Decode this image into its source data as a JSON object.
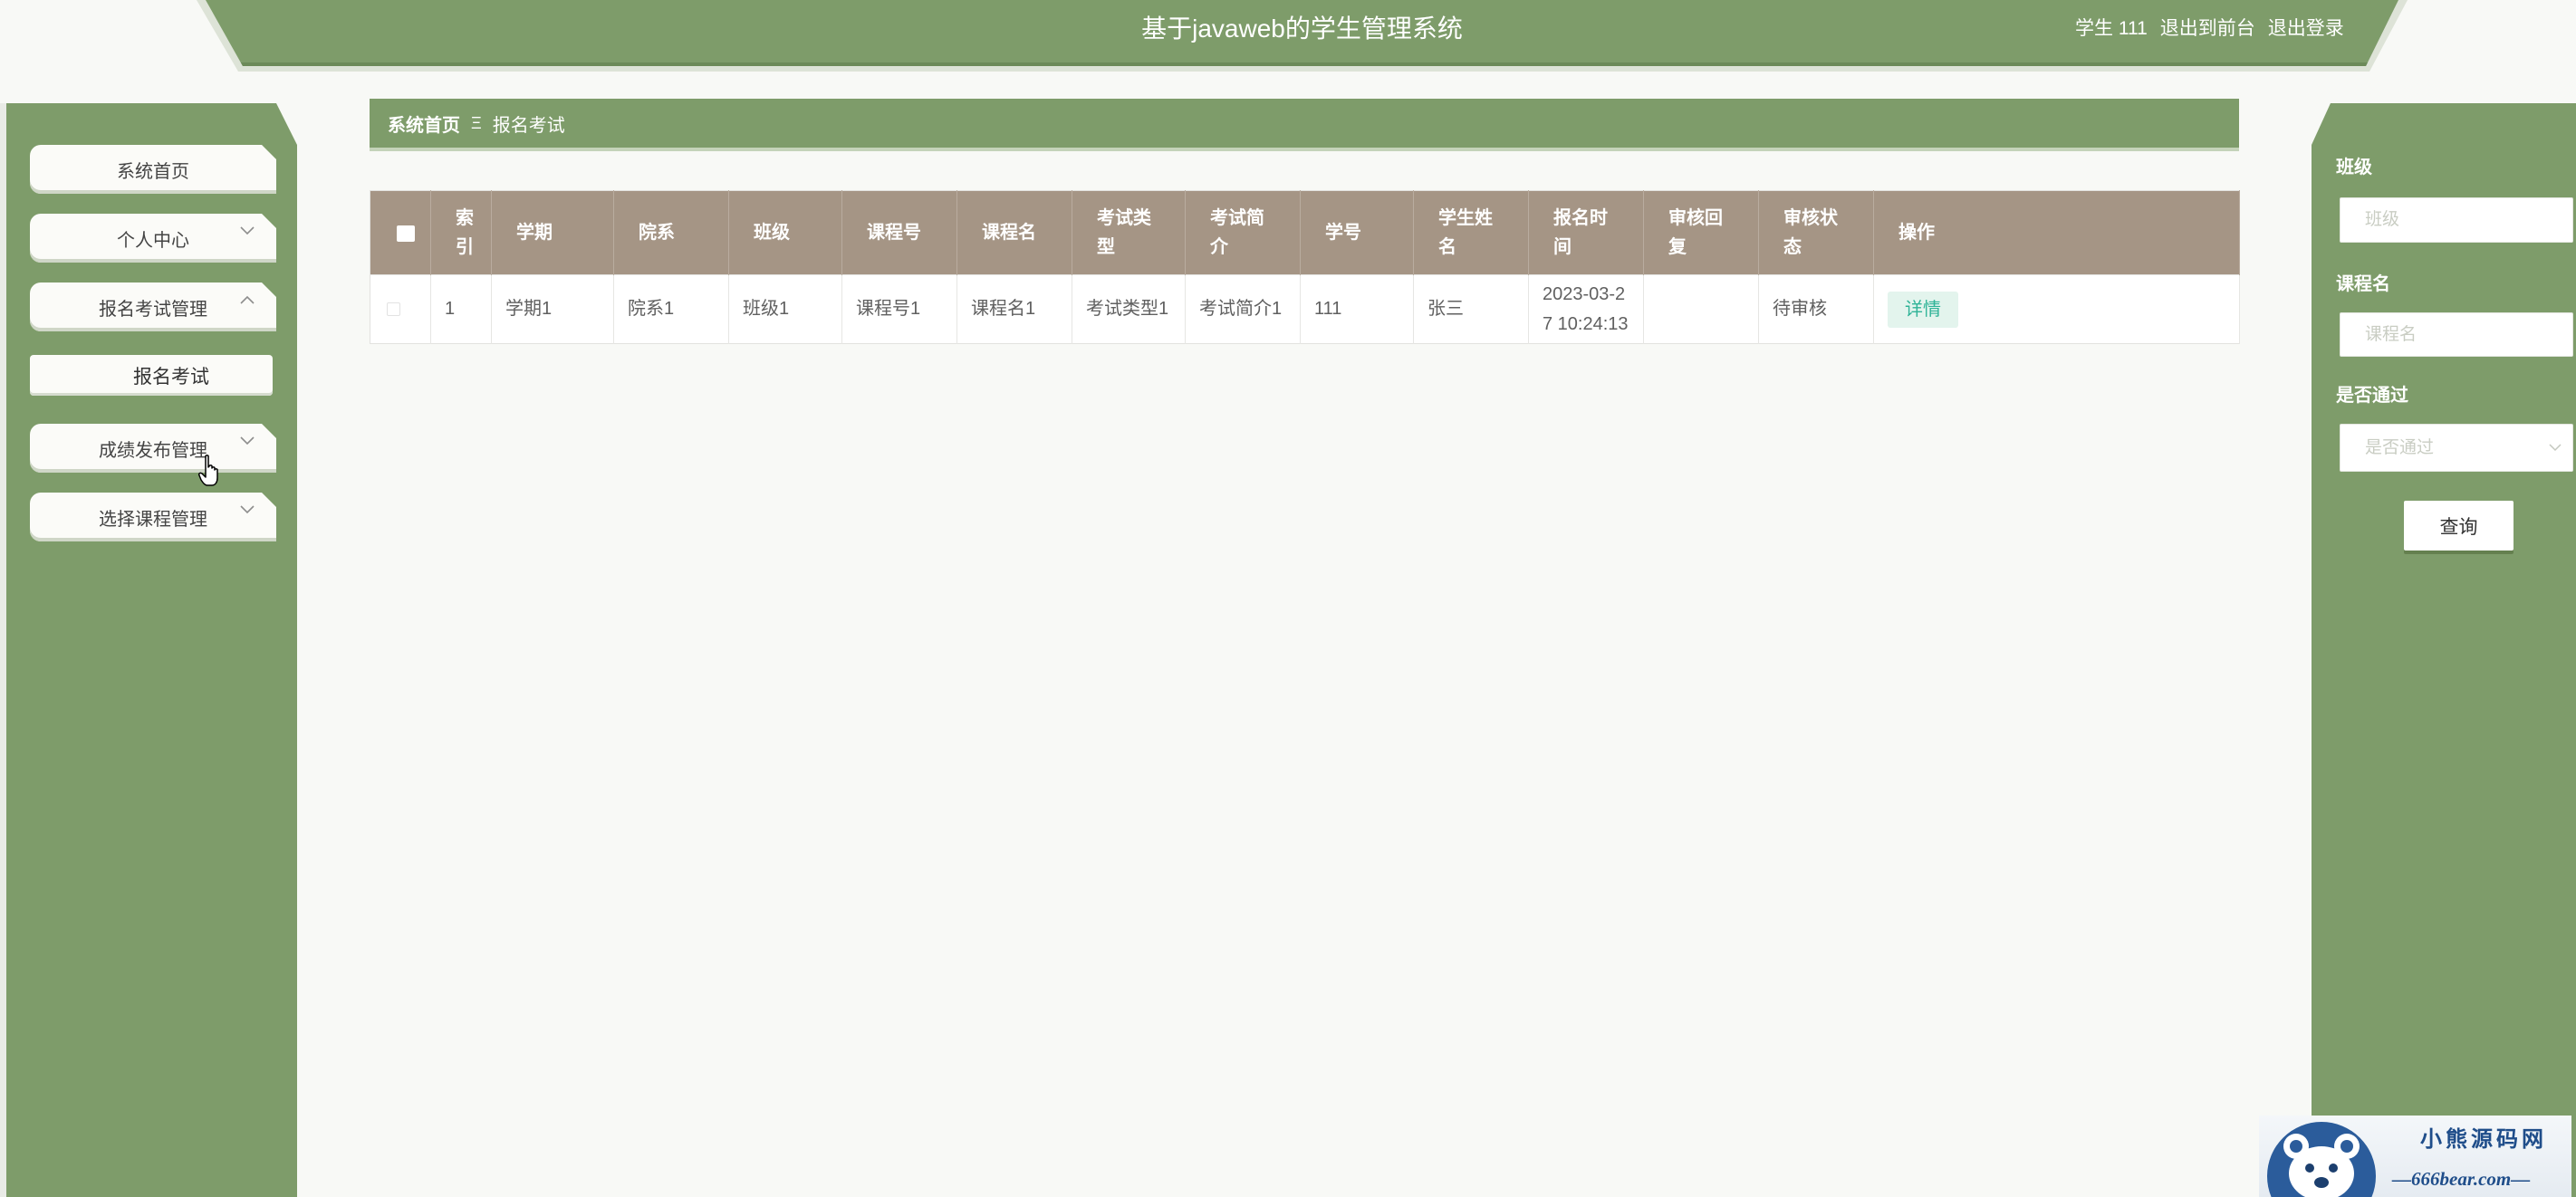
{
  "header": {
    "title": "基于javaweb的学生管理系统",
    "user": "学生 111",
    "front_link": "退出到前台",
    "logout_link": "退出登录"
  },
  "sidebar": {
    "items": [
      {
        "label": "系统首页"
      },
      {
        "label": "个人中心",
        "chevron": "chevron-down-icon"
      },
      {
        "label": "报名考试管理",
        "chevron": "chevron-up-icon",
        "expanded": true
      },
      {
        "label": "成绩发布管理",
        "chevron": "chevron-down-icon"
      },
      {
        "label": "选择课程管理",
        "chevron": "chevron-down-icon"
      }
    ],
    "sub_items": [
      {
        "label": "报名考试"
      }
    ]
  },
  "breadcrumb": {
    "home": "系统首页",
    "separator": "Ξ",
    "current": "报名考试"
  },
  "table": {
    "headers": [
      "索引",
      "学期",
      "院系",
      "班级",
      "课程号",
      "课程名",
      "考试类型",
      "考试简介",
      "学号",
      "学生姓名",
      "报名时间",
      "审核回复",
      "审核状态",
      "操作"
    ],
    "rows": [
      {
        "index": "1",
        "term": "学期1",
        "department": "院系1",
        "class_name": "班级1",
        "course_no": "课程号1",
        "course_name": "课程名1",
        "exam_type": "考试类型1",
        "exam_intro": "考试简介1",
        "student_no": "111",
        "student_name": "张三",
        "signup_time": "2023-03-27 10:24:13",
        "review_reply": "",
        "review_status": "待审核",
        "action": "详情"
      }
    ]
  },
  "search": {
    "class_label": "班级",
    "class_placeholder": "班级",
    "course_label": "课程名",
    "course_placeholder": "课程名",
    "passed_label": "是否通过",
    "passed_placeholder": "是否通过",
    "submit_label": "查询"
  },
  "watermark": {
    "name": "小熊源码网",
    "site": "—666bear.com—"
  },
  "colors": {
    "theme_green": "#7e9c6a",
    "table_header": "#a59585",
    "action_text": "#2fb397",
    "page_background": "#f8f9f6"
  }
}
